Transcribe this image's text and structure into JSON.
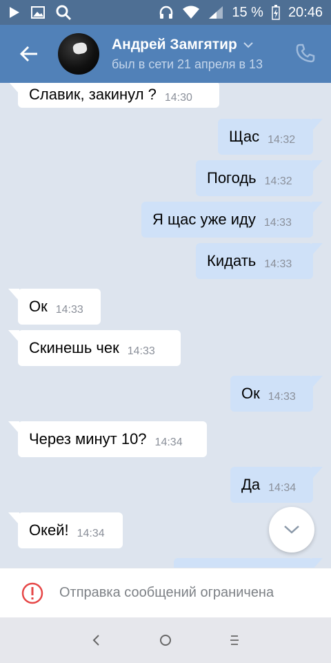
{
  "statusbar": {
    "battery": "15 %",
    "time": "20:46",
    "icons": [
      "play-icon",
      "image-icon",
      "search-icon",
      "headphones-icon",
      "wifi-icon",
      "signal-icon",
      "battery-icon"
    ]
  },
  "header": {
    "name": "Андрей Замгятир",
    "status": "был в сети 21 апреля в 13"
  },
  "messages": [
    {
      "dir": "in",
      "text": "Славик, закинул ?",
      "time": "14:30"
    },
    {
      "dir": "out",
      "text": "Щас",
      "time": "14:32"
    },
    {
      "dir": "out",
      "text": "Погодь",
      "time": "14:32"
    },
    {
      "dir": "out",
      "text": "Я щас уже иду",
      "time": "14:33"
    },
    {
      "dir": "out",
      "text": "Кидать",
      "time": "14:33"
    },
    {
      "dir": "in",
      "text": "Ок",
      "time": "14:33"
    },
    {
      "dir": "in",
      "text": "Скинешь чек",
      "time": "14:33"
    },
    {
      "dir": "out",
      "text": "Ок",
      "time": "14:33"
    },
    {
      "dir": "in",
      "text": "Через минут 10?",
      "time": "14:34"
    },
    {
      "dir": "out",
      "text": "Да",
      "time": "14:34"
    },
    {
      "dir": "in",
      "text": "Окей!",
      "time": "14:34"
    }
  ],
  "restriction": {
    "text": "Отправка сообщений ограничена"
  },
  "colors": {
    "header": "#5181b8",
    "statusbar": "#4e6f94",
    "chat_bg": "#dde4ee",
    "incoming": "#ffffff",
    "outgoing": "#cfe1f8",
    "alert": "#e64646"
  }
}
